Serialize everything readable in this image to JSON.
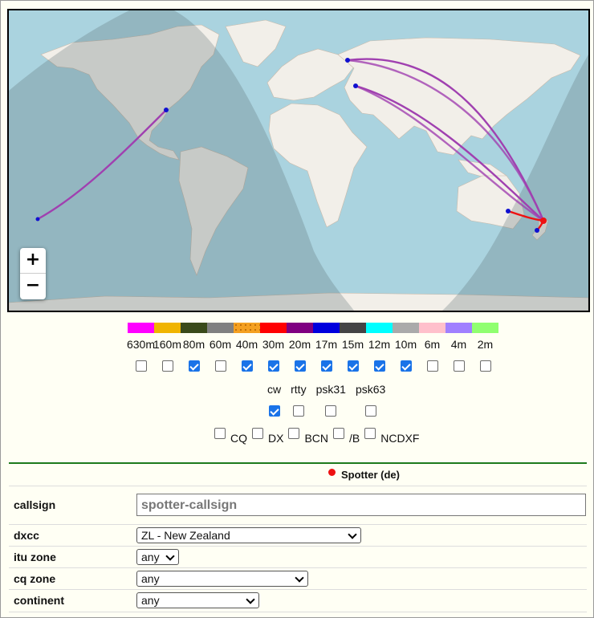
{
  "map": {
    "zoom_in": "+",
    "zoom_out": "−",
    "colors": {
      "ocean": "#aad3df",
      "land": "#f2efe9",
      "night": "#7e8a90",
      "path": "#a040b0",
      "path_local": "#ee1111",
      "spot": "#1010d0"
    }
  },
  "bands": [
    {
      "label": "630m",
      "color": "#ff00ff",
      "checked": false
    },
    {
      "label": "160m",
      "color": "#f0b400",
      "checked": false
    },
    {
      "label": "80m",
      "color": "#3a4a1a",
      "checked": true
    },
    {
      "label": "60m",
      "color": "#808080",
      "checked": false
    },
    {
      "label": "40m",
      "color": "#f4a020",
      "checked": true
    },
    {
      "label": "30m",
      "color": "#ff0000",
      "checked": true
    },
    {
      "label": "20m",
      "color": "#800080",
      "checked": true
    },
    {
      "label": "17m",
      "color": "#0000dd",
      "checked": true
    },
    {
      "label": "15m",
      "color": "#444444",
      "checked": true
    },
    {
      "label": "12m",
      "color": "#00ffff",
      "checked": true
    },
    {
      "label": "10m",
      "color": "#aaaaaa",
      "checked": true
    },
    {
      "label": "6m",
      "color": "#ffc0cb",
      "checked": false
    },
    {
      "label": "4m",
      "color": "#a080ff",
      "checked": false
    },
    {
      "label": "2m",
      "color": "#90ff70",
      "checked": false
    }
  ],
  "modes": [
    {
      "label": "cw",
      "checked": true
    },
    {
      "label": "rtty",
      "checked": false
    },
    {
      "label": "psk31",
      "checked": false
    },
    {
      "label": "psk63",
      "checked": false
    }
  ],
  "flags": [
    {
      "label": "CQ",
      "checked": false
    },
    {
      "label": "DX",
      "checked": false
    },
    {
      "label": "BCN",
      "checked": false
    },
    {
      "label": "/B",
      "checked": false
    },
    {
      "label": "NCDXF",
      "checked": false
    }
  ],
  "spotter": {
    "heading": "Spotter (de)",
    "callsign_label": "callsign",
    "callsign_placeholder": "spotter-callsign",
    "dxcc_label": "dxcc",
    "dxcc_value": "ZL - New Zealand",
    "itu_label": "itu zone",
    "itu_value": "any",
    "cq_label": "cq zone",
    "cq_value": "any",
    "continent_label": "continent",
    "continent_value": "any"
  }
}
